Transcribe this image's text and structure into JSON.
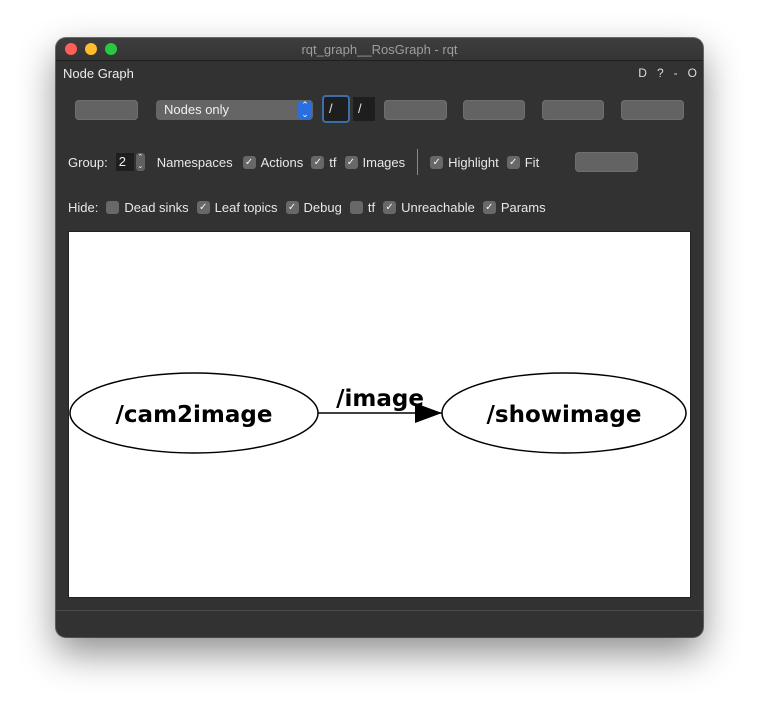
{
  "window": {
    "title": "rqt_graph__RosGraph - rqt"
  },
  "dock": {
    "title": "Node Graph",
    "controls": [
      "D",
      "?",
      "-",
      "O"
    ]
  },
  "toolbar": {
    "mode_combo": "Nodes only",
    "node_filter": "/",
    "topic_filter": "/"
  },
  "group_row": {
    "group_label": "Group:",
    "group_value": "2",
    "namespaces_label": "Namespaces",
    "actions": {
      "label": "Actions",
      "checked": true
    },
    "tf": {
      "label": "tf",
      "checked": true
    },
    "images": {
      "label": "Images",
      "checked": true
    },
    "highlight": {
      "label": "Highlight",
      "checked": true
    },
    "fit": {
      "label": "Fit",
      "checked": true
    }
  },
  "hide_row": {
    "label": "Hide:",
    "dead_sinks": {
      "label": "Dead sinks",
      "checked": false
    },
    "leaf_topics": {
      "label": "Leaf topics",
      "checked": true
    },
    "debug": {
      "label": "Debug",
      "checked": true
    },
    "tf": {
      "label": "tf",
      "checked": false
    },
    "unreachable": {
      "label": "Unreachable",
      "checked": true
    },
    "params": {
      "label": "Params",
      "checked": true
    }
  },
  "graph": {
    "nodes": [
      {
        "id": "cam2image",
        "label": "/cam2image"
      },
      {
        "id": "showimage",
        "label": "/showimage"
      }
    ],
    "edges": [
      {
        "from": "cam2image",
        "to": "showimage",
        "label": "/image"
      }
    ]
  },
  "colors": {
    "window_bg": "#323232",
    "accent": "#2a6fe0",
    "close": "#ff5f57",
    "minimize": "#febc2e",
    "maximize": "#28c840"
  }
}
